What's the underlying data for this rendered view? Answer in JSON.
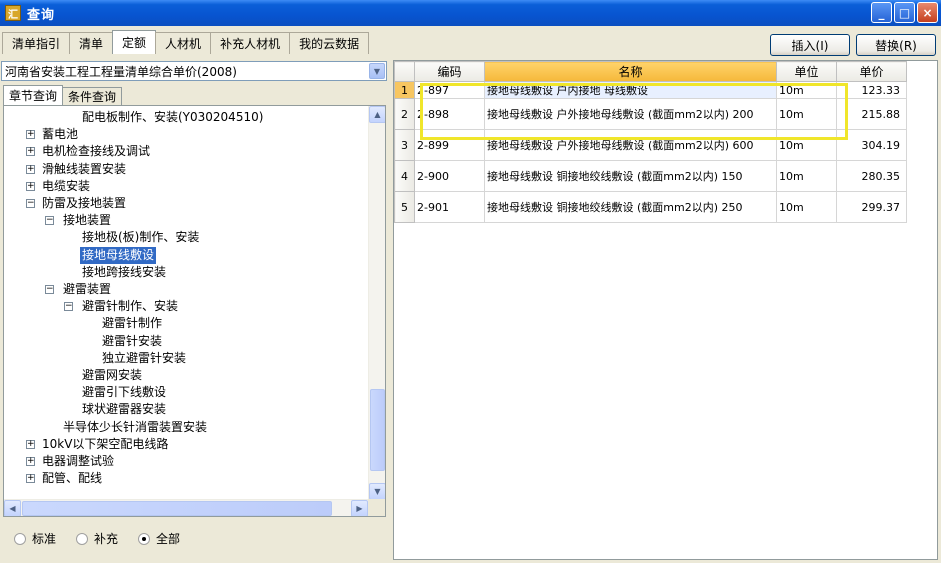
{
  "window": {
    "title": "查询",
    "icon_glyph": "汇"
  },
  "titlebar_buttons": {
    "minimize": "_",
    "maximize": "□",
    "close": "×"
  },
  "tabs": [
    {
      "label": "清单指引"
    },
    {
      "label": "清单"
    },
    {
      "label": "定额",
      "active": true
    },
    {
      "label": "人材机"
    },
    {
      "label": "补充人材机"
    },
    {
      "label": "我的云数据"
    }
  ],
  "actions": {
    "insert": "插入(I)",
    "replace": "替换(R)"
  },
  "left": {
    "dropdown_value": "河南省安装工程工程量清单综合单价(2008)",
    "dropdown_arrow": "▼",
    "subtabs": [
      {
        "label": "章节查询",
        "active": true
      },
      {
        "label": "条件查询"
      }
    ]
  },
  "tree": [
    {
      "label": "配电板制作、安装(Y030204510)",
      "level": 3,
      "expander": ""
    },
    {
      "label": "蓄电池",
      "level": 1,
      "expander": "+"
    },
    {
      "label": "电机检查接线及调试",
      "level": 1,
      "expander": "+"
    },
    {
      "label": "滑触线装置安装",
      "level": 1,
      "expander": "+"
    },
    {
      "label": "电缆安装",
      "level": 1,
      "expander": "+"
    },
    {
      "label": "防雷及接地装置",
      "level": 1,
      "expander": "−"
    },
    {
      "label": "接地装置",
      "level": 2,
      "expander": "−"
    },
    {
      "label": "接地极(板)制作、安装",
      "level": 3,
      "expander": ""
    },
    {
      "label": "接地母线敷设",
      "level": 3,
      "expander": "",
      "selected": true
    },
    {
      "label": "接地跨接线安装",
      "level": 3,
      "expander": ""
    },
    {
      "label": "避雷装置",
      "level": 2,
      "expander": "−"
    },
    {
      "label": "避雷针制作、安装",
      "level": 3,
      "expander": "−"
    },
    {
      "label": "避雷针制作",
      "level": 4,
      "expander": ""
    },
    {
      "label": "避雷针安装",
      "level": 4,
      "expander": ""
    },
    {
      "label": "独立避雷针安装",
      "level": 4,
      "expander": ""
    },
    {
      "label": "避雷网安装",
      "level": 3,
      "expander": ""
    },
    {
      "label": "避雷引下线敷设",
      "level": 3,
      "expander": ""
    },
    {
      "label": "球状避雷器安装",
      "level": 3,
      "expander": ""
    },
    {
      "label": "半导体少长针消雷装置安装",
      "level": 2,
      "expander": ""
    },
    {
      "label": "10kV以下架空配电线路",
      "level": 1,
      "expander": "+"
    },
    {
      "label": "电器调整试验",
      "level": 1,
      "expander": "+"
    },
    {
      "label": "配管、配线",
      "level": 1,
      "expander": "+"
    }
  ],
  "scroll_glyphs": {
    "up": "▲",
    "down": "▼",
    "left": "◀",
    "right": "▶"
  },
  "radios": [
    {
      "label": "标准",
      "checked": false
    },
    {
      "label": "补充",
      "checked": false
    },
    {
      "label": "全部",
      "checked": true
    }
  ],
  "grid": {
    "headers": [
      "",
      "编码",
      "名称",
      "单位",
      "单价"
    ],
    "rows": [
      {
        "num": "1",
        "code": "2-897",
        "name": "接地母线敷设 户内接地 母线敷设",
        "unit": "10m",
        "price": "123.33"
      },
      {
        "num": "2",
        "code": "2-898",
        "name": "接地母线敷设 户外接地母线敷设 (截面mm2以内) 200",
        "unit": "10m",
        "price": "215.88"
      },
      {
        "num": "3",
        "code": "2-899",
        "name": "接地母线敷设 户外接地母线敷设 (截面mm2以内) 600",
        "unit": "10m",
        "price": "304.19"
      },
      {
        "num": "4",
        "code": "2-900",
        "name": "接地母线敷设 铜接地绞线敷设 (截面mm2以内) 150",
        "unit": "10m",
        "price": "280.35"
      },
      {
        "num": "5",
        "code": "2-901",
        "name": "接地母线敷设 铜接地绞线敷设 (截面mm2以内) 250",
        "unit": "10m",
        "price": "299.37"
      }
    ]
  },
  "colors": {
    "titlebar": "#0854d0",
    "selection": "#316ac5",
    "highlight_box": "#f0e62a",
    "name_header": "#f5b83a"
  }
}
